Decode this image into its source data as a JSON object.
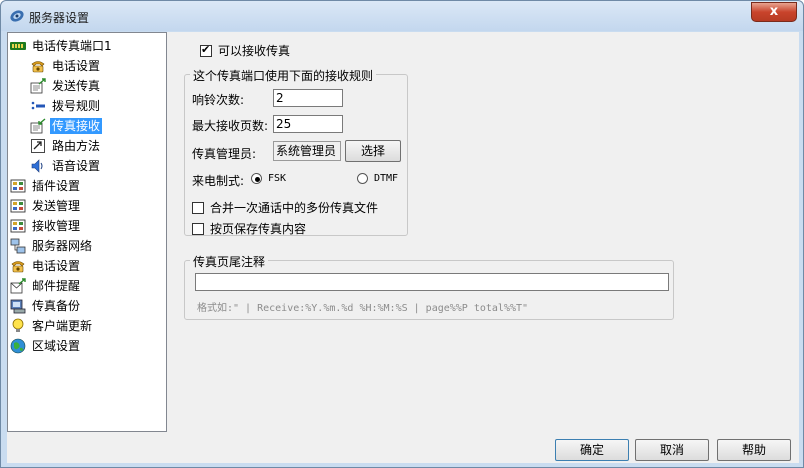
{
  "window": {
    "title": "服务器设置",
    "close_label": "x"
  },
  "tree": {
    "items": [
      {
        "label": "电话传真端口1",
        "icon": "port-card-icon",
        "level": 0
      },
      {
        "label": "电话设置",
        "icon": "telephone-icon",
        "level": 1
      },
      {
        "label": "发送传真",
        "icon": "fax-send-icon",
        "level": 1
      },
      {
        "label": "拨号规则",
        "icon": "dial-rules-icon",
        "level": 1
      },
      {
        "label": "传真接收",
        "icon": "fax-receive-icon",
        "level": 1,
        "selected": true
      },
      {
        "label": "路由方法",
        "icon": "routing-icon",
        "level": 1
      },
      {
        "label": "语音设置",
        "icon": "speaker-icon",
        "level": 1
      },
      {
        "label": "插件设置",
        "icon": "plugin-icon",
        "level": 0
      },
      {
        "label": "发送管理",
        "icon": "send-manage-icon",
        "level": 0
      },
      {
        "label": "接收管理",
        "icon": "receive-manage-icon",
        "level": 0
      },
      {
        "label": "服务器网络",
        "icon": "network-icon",
        "level": 0
      },
      {
        "label": "电话设置",
        "icon": "telephone-icon",
        "level": 0
      },
      {
        "label": "邮件提醒",
        "icon": "mail-icon",
        "level": 0
      },
      {
        "label": "传真备份",
        "icon": "backup-icon",
        "level": 0
      },
      {
        "label": "客户端更新",
        "icon": "bulb-icon",
        "level": 0
      },
      {
        "label": "区域设置",
        "icon": "globe-icon",
        "level": 0
      }
    ]
  },
  "panel": {
    "allow_receive": {
      "label": "可以接收传真",
      "checked": true
    },
    "rules_group": {
      "label": "这个传真端口使用下面的接收规则",
      "ring_count_label": "响铃次数:",
      "ring_count_value": "2",
      "max_pages_label": "最大接收页数:",
      "max_pages_value": "25",
      "manager_label": "传真管理员:",
      "manager_value": "系统管理员",
      "select_button": "选择",
      "dial_mode_label": "来电制式:",
      "fsk_label": "FSK",
      "dtmf_label": "DTMF",
      "fsk_checked": true,
      "merge_label": "合并一次通话中的多份传真文件",
      "merge_checked": false,
      "per_page_label": "按页保存传真内容",
      "per_page_checked": false
    },
    "footer_group": {
      "label": "传真页尾注释",
      "input_value": "",
      "hint": "格式如:\" | Receive:%Y.%m.%d %H:%M:%S | page%%P total%%T\""
    }
  },
  "buttons": {
    "ok": "确定",
    "cancel": "取消",
    "help": "帮助"
  }
}
